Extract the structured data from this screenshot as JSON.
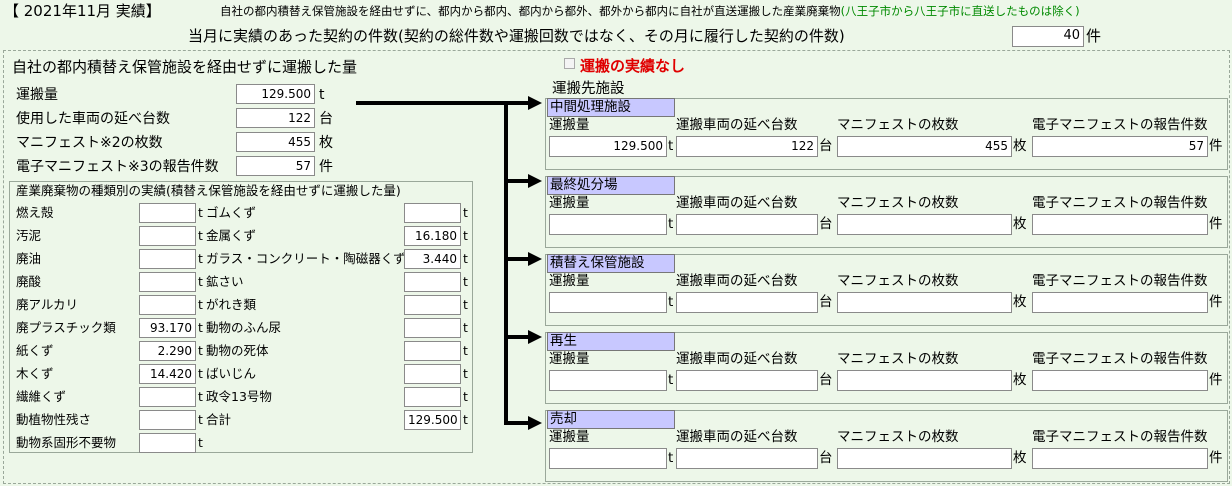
{
  "header": {
    "title": "【 2021年11月 実績】",
    "description": "自社の都内積替え保管施設を経由せずに、都内から都内、都内から都外、都外から都内に自社が直送運搬した産業廃棄物",
    "description_note": "(八王子市から八王子市に直送したものは除く)",
    "contract_label": "当月に実績のあった契約の件数(契約の総件数や運搬回数ではなく、その月に履行した契約の件数)",
    "contract_value": "40",
    "contract_unit": "件"
  },
  "left": {
    "title": "自社の都内積替え保管施設を経由せずに運搬した量",
    "summary": [
      {
        "label": "運搬量",
        "value": "129.500",
        "unit": "t"
      },
      {
        "label": "使用した車両の延べ台数",
        "value": "122",
        "unit": "台"
      },
      {
        "label": "マニフェスト※2の枚数",
        "value": "455",
        "unit": "枚"
      },
      {
        "label": "電子マニフェスト※3の報告件数",
        "value": "57",
        "unit": "件"
      }
    ],
    "waste_title": "産業廃棄物の種類別の実績(積替え保管施設を経由せずに運搬した量)",
    "waste_left": [
      {
        "label": "燃え殻",
        "value": "",
        "unit": "t"
      },
      {
        "label": "汚泥",
        "value": "",
        "unit": "t"
      },
      {
        "label": "廃油",
        "value": "",
        "unit": "t"
      },
      {
        "label": "廃酸",
        "value": "",
        "unit": "t"
      },
      {
        "label": "廃アルカリ",
        "value": "",
        "unit": "t"
      },
      {
        "label": "廃プラスチック類",
        "value": "93.170",
        "unit": "t"
      },
      {
        "label": "紙くず",
        "value": "2.290",
        "unit": "t"
      },
      {
        "label": "木くず",
        "value": "14.420",
        "unit": "t"
      },
      {
        "label": "繊維くず",
        "value": "",
        "unit": "t"
      },
      {
        "label": "動植物性残さ",
        "value": "",
        "unit": "t"
      },
      {
        "label": "動物系固形不要物",
        "value": "",
        "unit": "t"
      }
    ],
    "waste_right": [
      {
        "label": "ゴムくず",
        "value": "",
        "unit": "t"
      },
      {
        "label": "金属くず",
        "value": "16.180",
        "unit": "t"
      },
      {
        "label": "ガラス・コンクリート・陶磁器くず",
        "value": "3.440",
        "unit": "t"
      },
      {
        "label": "鉱さい",
        "value": "",
        "unit": "t"
      },
      {
        "label": "がれき類",
        "value": "",
        "unit": "t"
      },
      {
        "label": "動物のふん尿",
        "value": "",
        "unit": "t"
      },
      {
        "label": "動物の死体",
        "value": "",
        "unit": "t"
      },
      {
        "label": "ばいじん",
        "value": "",
        "unit": "t"
      },
      {
        "label": "政令13号物",
        "value": "",
        "unit": "t"
      },
      {
        "label": "合計",
        "value": "129.500",
        "unit": "t"
      }
    ]
  },
  "right": {
    "no_record_label": "運搬の実績なし",
    "dest_title": "運搬先施設",
    "col_labels": [
      "運搬量",
      "運搬車両の延べ台数",
      "マニフェストの枚数",
      "電子マニフェストの報告件数"
    ],
    "units": [
      "t",
      "台",
      "枚",
      "件"
    ],
    "facilities": [
      {
        "name": "中間処理施設",
        "values": [
          "129.500",
          "122",
          "455",
          "57"
        ]
      },
      {
        "name": "最終処分場",
        "values": [
          "",
          "",
          "",
          ""
        ]
      },
      {
        "name": "積替え保管施設",
        "values": [
          "",
          "",
          "",
          ""
        ]
      },
      {
        "name": "再生",
        "values": [
          "",
          "",
          "",
          ""
        ]
      },
      {
        "name": "売却",
        "values": [
          "",
          "",
          "",
          ""
        ]
      }
    ]
  }
}
